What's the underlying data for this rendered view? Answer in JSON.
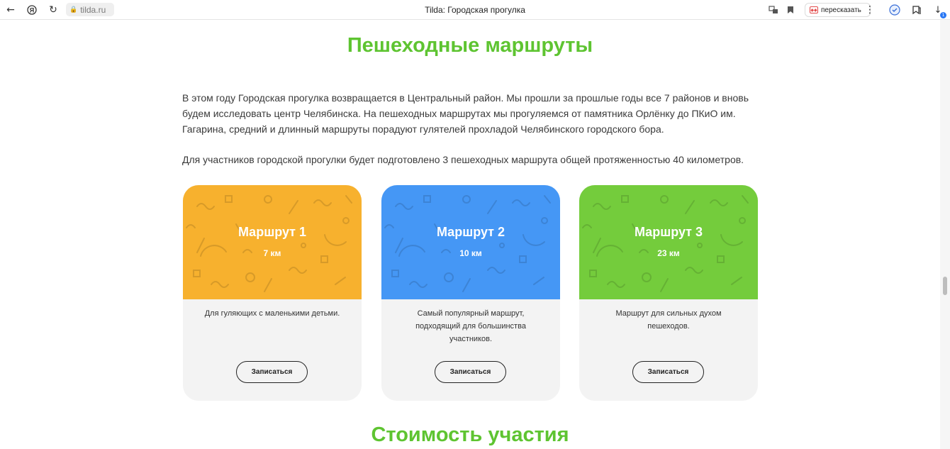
{
  "browser": {
    "url": "tilda.ru",
    "tab_title": "Tilda: Городская прогулка",
    "summarize_label": "пересказать"
  },
  "section": {
    "title": "Пешеходные маршруты",
    "intro": "В этом году Городская прогулка возвращается в Центральный район. Мы прошли за прошлые годы все 7 районов и вновь будем исследовать центр Челябинска. На пешеходных маршрутах мы прогуляемся от памятника Орлёнку до ПКиО им. Гагарина, средний и длинный маршруты порадуют гулятелей прохладой Челябинского городского бора.",
    "summary": "Для участников городской прогулки будет подготовлено 3 пешеходных маршрута общей протяженностью 40 километров."
  },
  "routes": [
    {
      "title": "Маршрут 1",
      "distance": "7 км",
      "description": "Для гуляющих с маленькими детьми.",
      "button": "Записаться",
      "color": "#f7b12e"
    },
    {
      "title": "Маршрут 2",
      "distance": "10 км",
      "description": "Самый популярный маршрут, подходящий для большинства участников.",
      "button": "Записаться",
      "color": "#4597f5"
    },
    {
      "title": "Маршрут 3",
      "distance": "23 км",
      "description": "Маршрут для сильных духом пешеходов.",
      "button": "Записаться",
      "color": "#74cc3c"
    }
  ],
  "next_section": {
    "title": "Стоимость участия"
  },
  "colors": {
    "accent_green": "#5ec431"
  },
  "icons": [
    "back-icon",
    "yandex-icon",
    "reload-icon",
    "lock-icon",
    "translate-icon",
    "bookmark-icon",
    "summarize-icon",
    "more-icon",
    "shield-icon",
    "collections-icon",
    "downloads-icon"
  ]
}
